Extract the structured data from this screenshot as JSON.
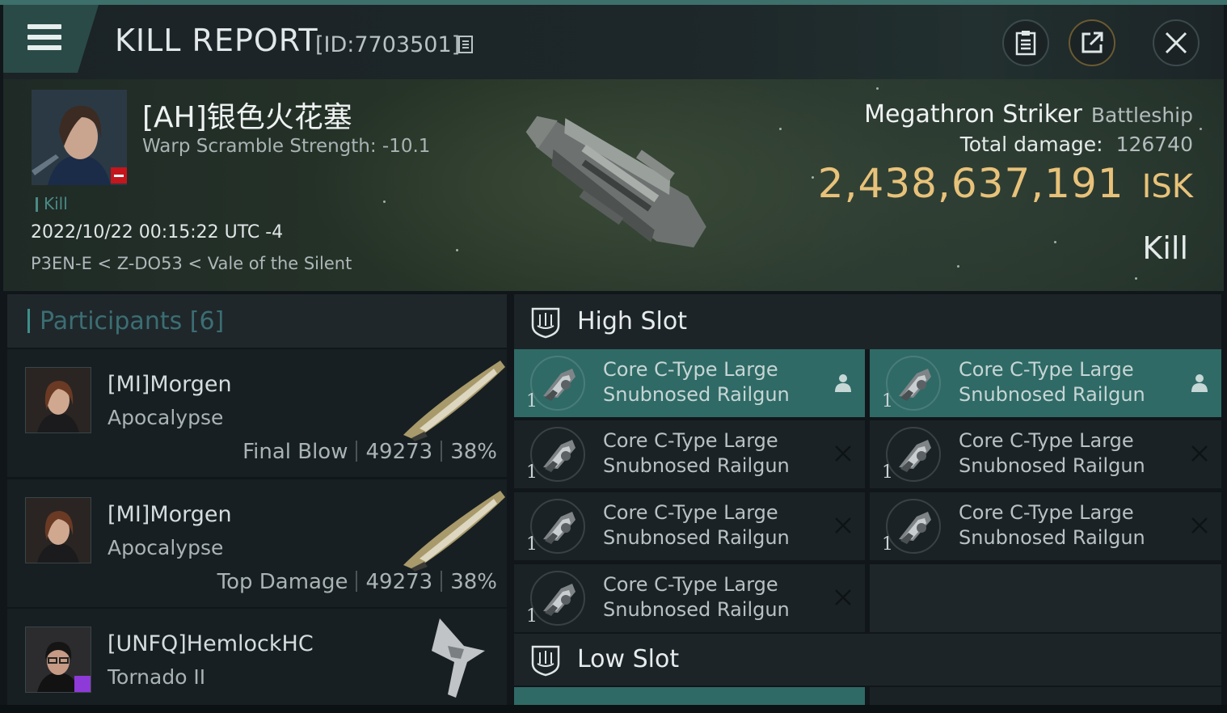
{
  "header": {
    "title": "KILL REPORT",
    "report_id": "[ID:7703501]"
  },
  "victim": {
    "name": "[AH]银色火花塞",
    "warp_scramble": "Warp Scramble Strength: -10.1",
    "kill_tag": "Kill",
    "datetime": "2022/10/22 00:15:22 UTC -4",
    "location": "P3EN-E < Z-DO53 < Vale of the Silent",
    "ship_name": "Megathron Striker",
    "ship_class": "Battleship",
    "total_damage_label": "Total damage:",
    "total_damage_value": "126740",
    "isk_value": "2,438,637,191",
    "isk_unit": "ISK",
    "loss_type": "Kill"
  },
  "participants": {
    "title": "Participants [6]",
    "items": [
      {
        "name": "[MI]Morgen",
        "ship": "Apocalypse",
        "role": "Final Blow",
        "damage": "49273",
        "percent": "38%"
      },
      {
        "name": "[MI]Morgen",
        "ship": "Apocalypse",
        "role": "Top Damage",
        "damage": "49273",
        "percent": "38%"
      },
      {
        "name": "[UNFQ]HemlockHC",
        "ship": "Tornado II"
      }
    ]
  },
  "slots": {
    "high_title": "High Slot",
    "low_title": "Low Slot",
    "high_modules": [
      {
        "qty": "1",
        "name": "Core C-Type Large Snubnosed Railgun",
        "status": "fitted"
      },
      {
        "qty": "1",
        "name": "Core C-Type Large Snubnosed Railgun",
        "status": "fitted"
      },
      {
        "qty": "1",
        "name": "Core C-Type Large Snubnosed Railgun",
        "status": "destroyed"
      },
      {
        "qty": "1",
        "name": "Core C-Type Large Snubnosed Railgun",
        "status": "destroyed"
      },
      {
        "qty": "1",
        "name": "Core C-Type Large Snubnosed Railgun",
        "status": "destroyed"
      },
      {
        "qty": "1",
        "name": "Core C-Type Large Snubnosed Railgun",
        "status": "destroyed"
      },
      {
        "qty": "1",
        "name": "Core C-Type Large Snubnosed Railgun",
        "status": "destroyed"
      }
    ]
  },
  "colors": {
    "accent": "#2f6a66",
    "isk": "#e8c27a",
    "security_negative": "#c4161c"
  },
  "icons": [
    "menu-icon",
    "copy-icon",
    "clipboard-icon",
    "share-icon",
    "close-icon",
    "shield-slot-icon",
    "pilot-icon",
    "x-icon"
  ]
}
